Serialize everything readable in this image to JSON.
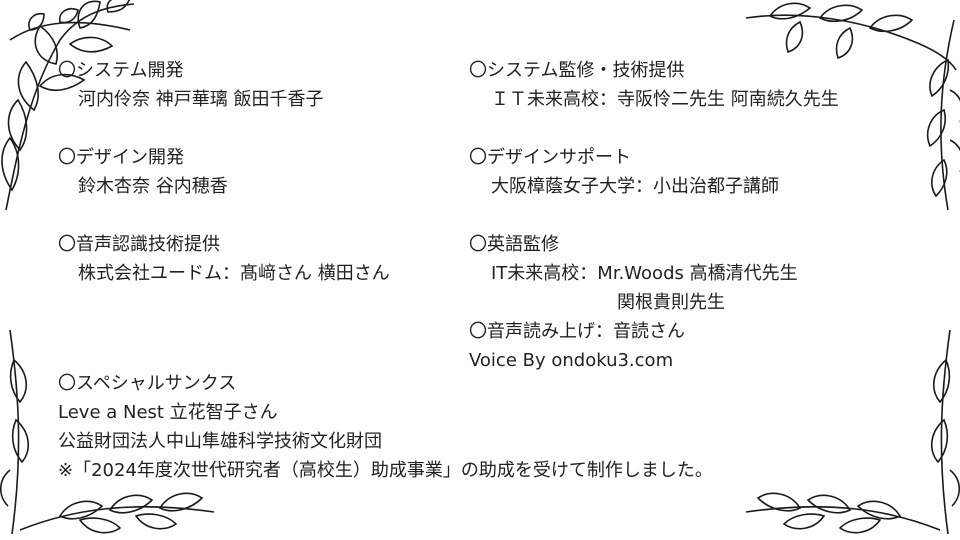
{
  "credits": {
    "system_dev": {
      "heading": "〇システム開発",
      "names": "河内伶奈 神戸華璃 飯田千香子"
    },
    "design_dev": {
      "heading": "〇デザイン開発",
      "names": "鈴木杏奈 谷内穂香"
    },
    "speech_recognition": {
      "heading": "〇音声認識技術提供",
      "names": "株式会社ユードム：髙﨑さん 横田さん"
    },
    "system_supervision": {
      "heading": "〇システム監修・技術提供",
      "names": "ＩＴ未来高校：寺阪怜二先生 阿南続久先生"
    },
    "design_support": {
      "heading": "〇デザインサポート",
      "names": "大阪樟蔭女子大学：小出治都子講師"
    },
    "english_supervision": {
      "heading": "〇英語監修",
      "line1": "IT未来高校：Mr.Woods 高橋清代先生",
      "line2": "関根貴則先生"
    },
    "voice_reading": {
      "heading": "〇音声読み上げ：音読さん",
      "line": "Voice By ondoku3.com"
    },
    "special_thanks": {
      "heading": "〇スペシャルサンクス",
      "line1": "Leve a Nest 立花智子さん",
      "line2": "公益財団法人中山隼雄科学技術文化財団",
      "note": "※「2024年度次世代研究者（高校生）助成事業」の助成を受けて制作しました。"
    }
  },
  "colors": {
    "text": "#222222",
    "ornament": "#1a1a1a",
    "background": "#ffffff"
  },
  "ornaments": [
    "leaf-branch-top-left",
    "leaf-branch-top-right",
    "leaf-branch-bottom-left",
    "leaf-branch-bottom-right"
  ]
}
